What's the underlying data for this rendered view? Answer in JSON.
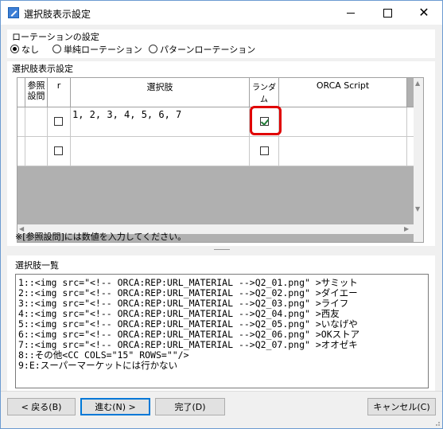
{
  "window": {
    "title": "選択肢表示設定",
    "icon": "edit-pencil-icon"
  },
  "rotation": {
    "group_label": "ローテーションの設定",
    "options": [
      {
        "label": "なし",
        "selected": true
      },
      {
        "label": "単純ローテーション",
        "selected": false
      },
      {
        "label": "パターンローテーション",
        "selected": false
      }
    ]
  },
  "display": {
    "group_label": "選択肢表示設定",
    "columns": [
      "参照\n設問",
      "r",
      "選択肢",
      "ランダム",
      "ORCA Script"
    ],
    "rows": [
      {
        "ref": "",
        "r_checked": false,
        "choices": "1, 2, 3, 4, 5, 6, 7",
        "random_checked": true,
        "script": ""
      },
      {
        "ref": "",
        "r_checked": false,
        "choices": "",
        "random_checked": false,
        "script": ""
      }
    ],
    "note": "※[参照設問]には数値を入力してください。",
    "highlight_color": "#e00000"
  },
  "choice_list": {
    "group_label": "選択肢一覧",
    "lines": [
      "1::<img src=\"<!-- ORCA:REP:URL_MATERIAL -->Q2_01.png\" >サミット",
      "2::<img src=\"<!-- ORCA:REP:URL_MATERIAL -->Q2_02.png\" >ダイエー",
      "3::<img src=\"<!-- ORCA:REP:URL_MATERIAL -->Q2_03.png\" >ライフ",
      "4::<img src=\"<!-- ORCA:REP:URL_MATERIAL -->Q2_04.png\" >西友",
      "5::<img src=\"<!-- ORCA:REP:URL_MATERIAL -->Q2_05.png\" >いなげや",
      "6::<img src=\"<!-- ORCA:REP:URL_MATERIAL -->Q2_06.png\" >OKストア",
      "7::<img src=\"<!-- ORCA:REP:URL_MATERIAL -->Q2_07.png\" >オオゼキ",
      "8::その他<CC COLS=\"15\" ROWS=\"\"/>",
      "9:E:スーパーマーケットには行かない"
    ]
  },
  "buttons": {
    "back": "< 戻る(B)",
    "next": "進む(N) >",
    "finish": "完了(D)",
    "cancel": "キャンセル(C)"
  }
}
